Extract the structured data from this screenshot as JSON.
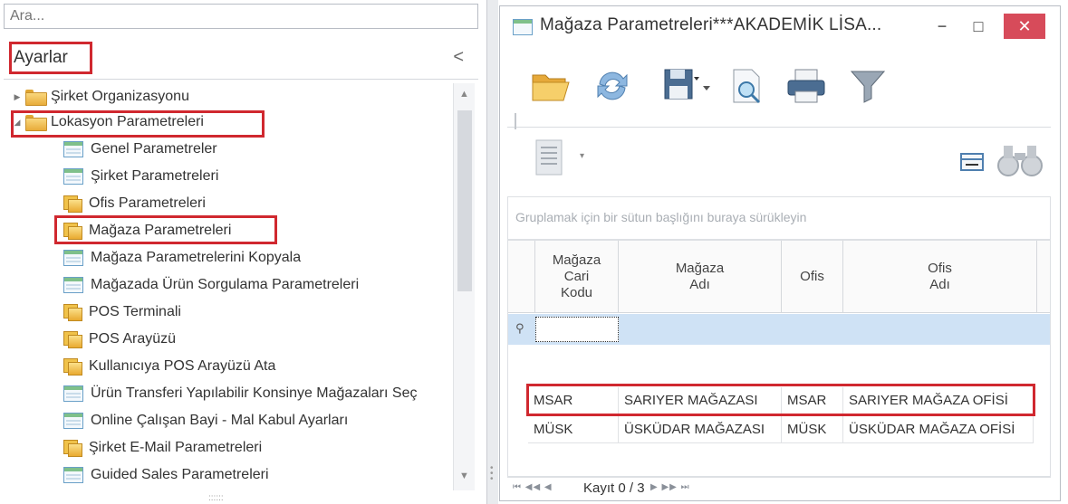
{
  "search": {
    "placeholder": "Ara..."
  },
  "sidebar": {
    "title": "Ayarlar",
    "collapse_glyph": "<",
    "items": [
      {
        "label": "Şirket Organizasyonu",
        "type": "folder",
        "expander": "▶"
      },
      {
        "label": "Lokasyon Parametreleri",
        "type": "folder",
        "expander": "◢"
      },
      {
        "label": "Genel Parametreler",
        "type": "form"
      },
      {
        "label": "Şirket Parametreleri",
        "type": "form"
      },
      {
        "label": "Ofis Parametreleri",
        "type": "sfolder"
      },
      {
        "label": "Mağaza Parametreleri",
        "type": "sfolder"
      },
      {
        "label": "Mağaza Parametrelerini Kopyala",
        "type": "form"
      },
      {
        "label": "Mağazada Ürün Sorgulama Parametreleri",
        "type": "form"
      },
      {
        "label": "POS Terminali",
        "type": "sfolder"
      },
      {
        "label": "POS Arayüzü",
        "type": "sfolder"
      },
      {
        "label": "Kullanıcıya POS Arayüzü Ata",
        "type": "sfolder"
      },
      {
        "label": "Ürün Transferi Yapılabilir Konsinye Mağazaları Seç",
        "type": "form"
      },
      {
        "label": "Online Çalışan Bayi - Mal Kabul Ayarları",
        "type": "form"
      },
      {
        "label": "Şirket E-Mail Parametreleri",
        "type": "sfolder"
      },
      {
        "label": "Guided Sales Parametreleri",
        "type": "form"
      }
    ]
  },
  "window": {
    "title": "Mağaza Parametreleri***AKADEMİK LİSA...",
    "min_glyph": "−",
    "max_glyph": "□",
    "close_glyph": "✕",
    "group_hint": "Gruplamak için bir sütun başlığını buraya sürükleyin",
    "columns": [
      {
        "lines": [
          "Mağaza",
          "Cari",
          "Kodu"
        ]
      },
      {
        "lines": [
          "Mağaza",
          "Adı"
        ]
      },
      {
        "lines": [
          "Ofis"
        ]
      },
      {
        "lines": [
          "Ofis",
          "Adı"
        ]
      }
    ],
    "rows": [
      [
        "MSAR",
        "SARIYER MAĞAZASI",
        "MSAR",
        "SARIYER MAĞAZA OFİSİ"
      ],
      [
        "MÜSK",
        "ÜSKÜDAR MAĞAZASI",
        "MÜSK",
        "ÜSKÜDAR MAĞAZA OFİSİ"
      ]
    ],
    "nav": {
      "left_glyphs": "⏮ ◀◀ ◀",
      "record": "Kayıt 0 / 3",
      "right_glyphs": "▶ ▶▶ ⏭"
    }
  }
}
